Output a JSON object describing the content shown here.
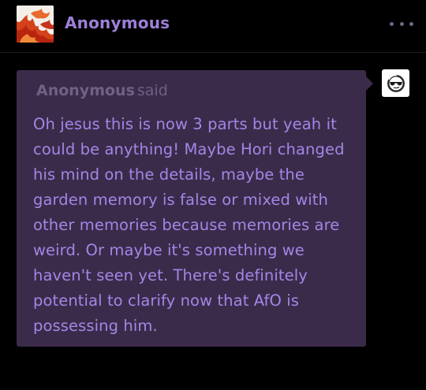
{
  "post": {
    "author": "Anonymous",
    "avatar_icon": "flame-avatar-icon",
    "more_icon": "more-options-icon"
  },
  "ask": {
    "asker_name": "Anonymous",
    "said_label": "said",
    "question_text": "Oh jesus this is now 3 parts but yeah it could be anything! Maybe Hori changed his mind on the details, maybe the garden memory is false or mixed with other memories because memories are weird. Or maybe it's something we haven't seen yet. There's definitely potential to clarify now that AfO is possessing him.",
    "answerer_avatar_icon": "sunglasses-avatar-icon"
  },
  "colors": {
    "background": "#000000",
    "accent": "#9d7fd8",
    "bubble": "#3b2b4a",
    "question_text": "#a486e6",
    "muted": "#6e6081"
  }
}
